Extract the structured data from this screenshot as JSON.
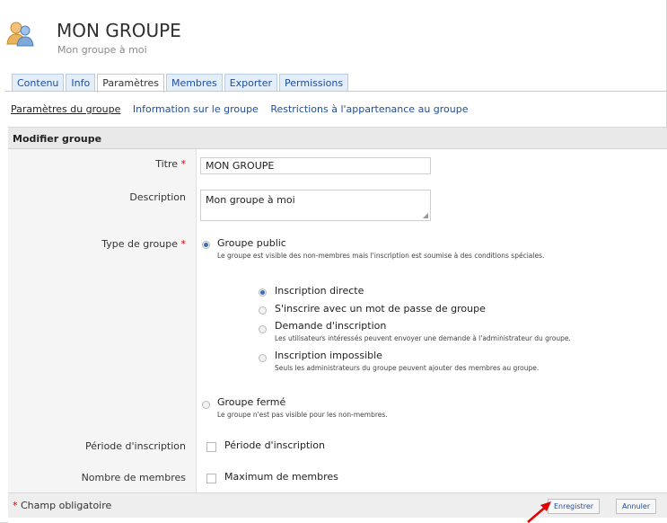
{
  "header": {
    "title": "MON GROUPE",
    "subtitle": "Mon groupe à moi",
    "icon": "group-icon"
  },
  "tabs": [
    {
      "label": "Contenu",
      "active": false
    },
    {
      "label": "Info",
      "active": false
    },
    {
      "label": "Paramètres",
      "active": true
    },
    {
      "label": "Membres",
      "active": false
    },
    {
      "label": "Exporter",
      "active": false
    },
    {
      "label": "Permissions",
      "active": false
    }
  ],
  "subnav": [
    {
      "label": "Paramètres du groupe",
      "current": true
    },
    {
      "label": "Information sur le groupe",
      "current": false
    },
    {
      "label": "Restrictions à l'appartenance au groupe",
      "current": false
    }
  ],
  "form": {
    "section_title": "Modifier groupe",
    "title_label": "Titre",
    "required_mark": "*",
    "title_value": "MON GROUPE",
    "description_label": "Description",
    "description_value": "Mon groupe à moi",
    "type_label": "Type de groupe",
    "public_label": "Groupe public",
    "public_help": "Le groupe est visible des non-membres mais l'inscription est soumise à des conditions spéciales.",
    "direct_label": "Inscription directe",
    "password_label": "S'inscrire avec un mot de passe de groupe",
    "request_label": "Demande d'inscription",
    "request_help": "Les utilisateurs intéressés peuvent envoyer une demande à l'administrateur du groupe.",
    "impossible_label": "Inscription impossible",
    "impossible_help": "Seuls les administrateurs du groupe peuvent ajouter des membres au groupe.",
    "closed_label": "Groupe fermé",
    "closed_help": "Le groupe n'est pas visible pour les non-membres.",
    "period_label": "Période d'inscription",
    "period_checkbox": "Période d'inscription",
    "members_label": "Nombre de membres",
    "members_checkbox": "Maximum de membres"
  },
  "footer": {
    "required_note_mark": "*",
    "required_note": "Champ obligatoire",
    "save": "Enregistrer",
    "cancel": "Annuler"
  },
  "colors": {
    "link": "#1f4d9a",
    "required": "#d40000",
    "arrow": "#e00000"
  }
}
